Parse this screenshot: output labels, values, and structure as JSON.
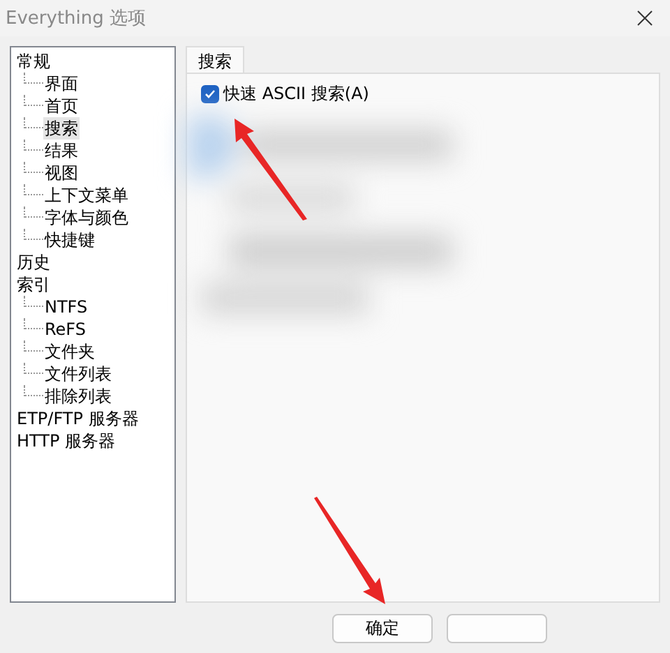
{
  "window": {
    "title": "Everything 选项"
  },
  "tree": [
    {
      "label": "常规",
      "selected": false,
      "children": [
        {
          "label": "界面",
          "selected": false
        },
        {
          "label": "首页",
          "selected": false
        },
        {
          "label": "搜索",
          "selected": true
        },
        {
          "label": "结果",
          "selected": false
        },
        {
          "label": "视图",
          "selected": false
        },
        {
          "label": "上下文菜单",
          "selected": false
        },
        {
          "label": "字体与颜色",
          "selected": false
        },
        {
          "label": "快捷键",
          "selected": false
        }
      ]
    },
    {
      "label": "历史",
      "selected": false
    },
    {
      "label": "索引",
      "selected": false,
      "children": [
        {
          "label": "NTFS",
          "selected": false
        },
        {
          "label": "ReFS",
          "selected": false
        },
        {
          "label": "文件夹",
          "selected": false
        },
        {
          "label": "文件列表",
          "selected": false
        },
        {
          "label": "排除列表",
          "selected": false
        }
      ]
    },
    {
      "label": "ETP/FTP 服务器",
      "selected": false
    },
    {
      "label": "HTTP 服务器",
      "selected": false
    }
  ],
  "tabs": [
    {
      "label": "搜索",
      "selected": true
    }
  ],
  "options": [
    {
      "label": "快速 ASCII 搜索(A)",
      "checked": true
    }
  ],
  "buttons": [
    {
      "label": "确定"
    }
  ]
}
